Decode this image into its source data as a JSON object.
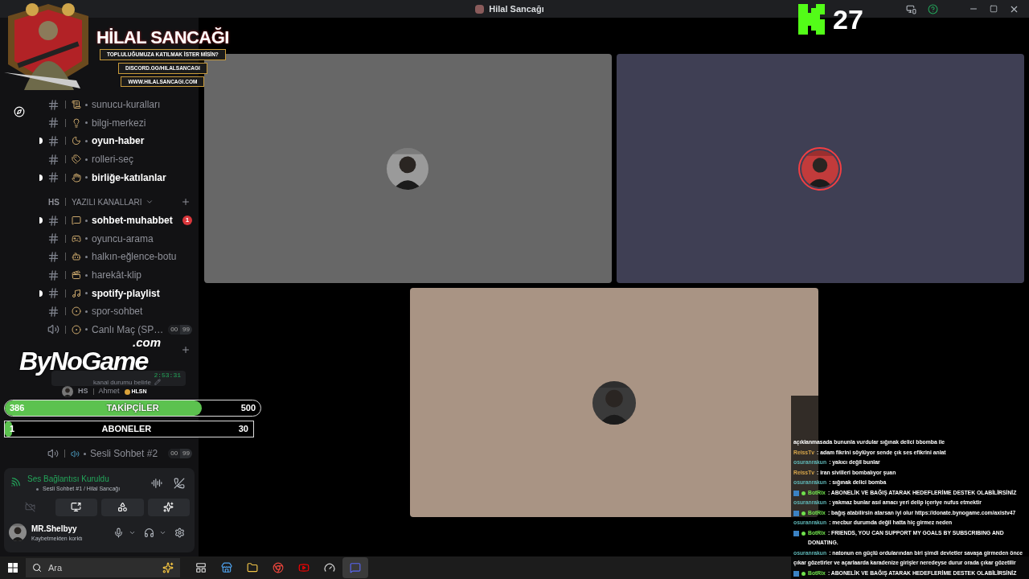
{
  "window": {
    "title": "Hilal Sancağı"
  },
  "banner": {
    "title": "HİLAL SANCAĞI",
    "lines": [
      "TOPLULUĞUMUZA KATILMAK İSTER MİSİN?",
      "DISCORD.GG/HILALSANCAGI",
      "WWW.HILALSANCAGI.COM"
    ]
  },
  "channels": [
    {
      "kind": "text",
      "name": "sunucu-kuralları",
      "unread": false
    },
    {
      "kind": "text",
      "name": "bilgi-merkezi",
      "unread": false
    },
    {
      "kind": "text",
      "name": "oyun-haber",
      "unread": true
    },
    {
      "kind": "text",
      "name": "rolleri-seç",
      "unread": false
    },
    {
      "kind": "text",
      "name": "birliğe-katılanlar",
      "unread": true
    },
    {
      "kind": "category",
      "tag": "HS",
      "name": "YAZILI KANALLARI"
    },
    {
      "kind": "text",
      "name": "sohbet-muhabbet",
      "unread": true,
      "mentions": "1"
    },
    {
      "kind": "text",
      "name": "oyuncu-arama",
      "unread": false
    },
    {
      "kind": "text",
      "name": "halkın-eğlence-botu",
      "unread": false
    },
    {
      "kind": "text",
      "name": "harekât-klip",
      "unread": false
    },
    {
      "kind": "text",
      "name": "spotify-playlist",
      "unread": true
    },
    {
      "kind": "text",
      "name": "spor-sohbet",
      "unread": false
    },
    {
      "kind": "voice",
      "name": "Canlı Maç (SP…",
      "count": "00",
      "limit": "99"
    }
  ],
  "active_voice": {
    "timer": "2:53:31",
    "status": "kanal durumu belirle",
    "member": {
      "tag": "HS",
      "name": "Ahmet",
      "badge": "HLSN"
    }
  },
  "voice_channels": [
    {
      "name": "Sesli Sohbet #2",
      "count": "00",
      "limit": "99"
    }
  ],
  "voice_panel": {
    "title": "Ses Bağlantısı Kuruldu",
    "channel": "Sesli Sohbet #1 / Hilal Sancağı",
    "camera_on": false
  },
  "user": {
    "name": "MR.Shelbyy",
    "status": "Kaybetmekten korktı"
  },
  "viewers": {
    "count": "27"
  },
  "logo": {
    "name": "ByNoGame",
    "suffix": ".com"
  },
  "goals": [
    {
      "current": "386",
      "label": "TAKİPÇİLER",
      "goal": "500",
      "level": 0.772,
      "rounded": true
    },
    {
      "current": "1",
      "label": "ABONELER",
      "goal": "30",
      "level": 0.03,
      "rounded": false
    }
  ],
  "chat": [
    {
      "kind": "continuation",
      "text": "açıklanmasada bununla vurdular sığınak delici bbomba ile"
    },
    {
      "kind": "message",
      "user": "ReissTv",
      "color": "#d6a54a",
      "bot": false,
      "text": ": adam fikrini söylüyor sende çık ses efikrini anlat"
    },
    {
      "kind": "message",
      "user": "osuranrakun",
      "color": "#5fb6b6",
      "bot": false,
      "text": ": yakıcı değil bunlar"
    },
    {
      "kind": "message",
      "user": "ReissTv",
      "color": "#d6a54a",
      "bot": false,
      "text": ": iran sivilleri bombalıyor şuan"
    },
    {
      "kind": "message",
      "user": "osuranrakun",
      "color": "#5fb6b6",
      "bot": false,
      "text": ": sığınak delici bomba"
    },
    {
      "kind": "message",
      "user": "BotRix",
      "color": "#6fe04c",
      "bot": true,
      "text": ": ABONELİK VE BAĞIŞ ATARAK HEDEFLERİME DESTEK OLABİLİRSİNİZ"
    },
    {
      "kind": "message",
      "user": "osuranrakun",
      "color": "#5fb6b6",
      "bot": false,
      "text": ": yakmaz bunlar asıl amacı yeri delip içeriye nufus etmektir"
    },
    {
      "kind": "message",
      "user": "BotRix",
      "color": "#6fe04c",
      "bot": true,
      "text": ": bağış atabilirsin atarsan iyi olur https://donate.bynogame.com/axistv47"
    },
    {
      "kind": "message",
      "user": "osuranrakun",
      "color": "#5fb6b6",
      "bot": false,
      "text": ": mecbur durumda değil hatta hiç girmez neden"
    },
    {
      "kind": "message",
      "user": "BotRix",
      "color": "#6fe04c",
      "bot": true,
      "text": ": FRIENDS, YOU CAN SUPPORT MY GOALS BY SUBSCRIBING AND DONATING."
    },
    {
      "kind": "message",
      "user": "osuranrakun",
      "color": "#5fb6b6",
      "bot": false,
      "text": ": natonun en güçlü ordularından biri şimdi devletler savaşa girmeden önce çıkar gözetirler ve açarlaarda karadenize girişler neredeyse durur orada çıkar gözetilir"
    },
    {
      "kind": "message",
      "user": "BotRix",
      "color": "#6fe04c",
      "bot": true,
      "text": ": ABONELİK VE BAĞIŞ ATARAK HEDEFLERİME DESTEK OLABİLİRSİNİZ"
    }
  ],
  "taskbar": {
    "search_placeholder": "Ara",
    "apps": [
      {
        "active": false
      },
      {
        "active": false
      },
      {
        "active": false
      },
      {
        "active": false
      },
      {
        "active": false
      },
      {
        "active": false
      },
      {
        "active": true
      }
    ]
  }
}
